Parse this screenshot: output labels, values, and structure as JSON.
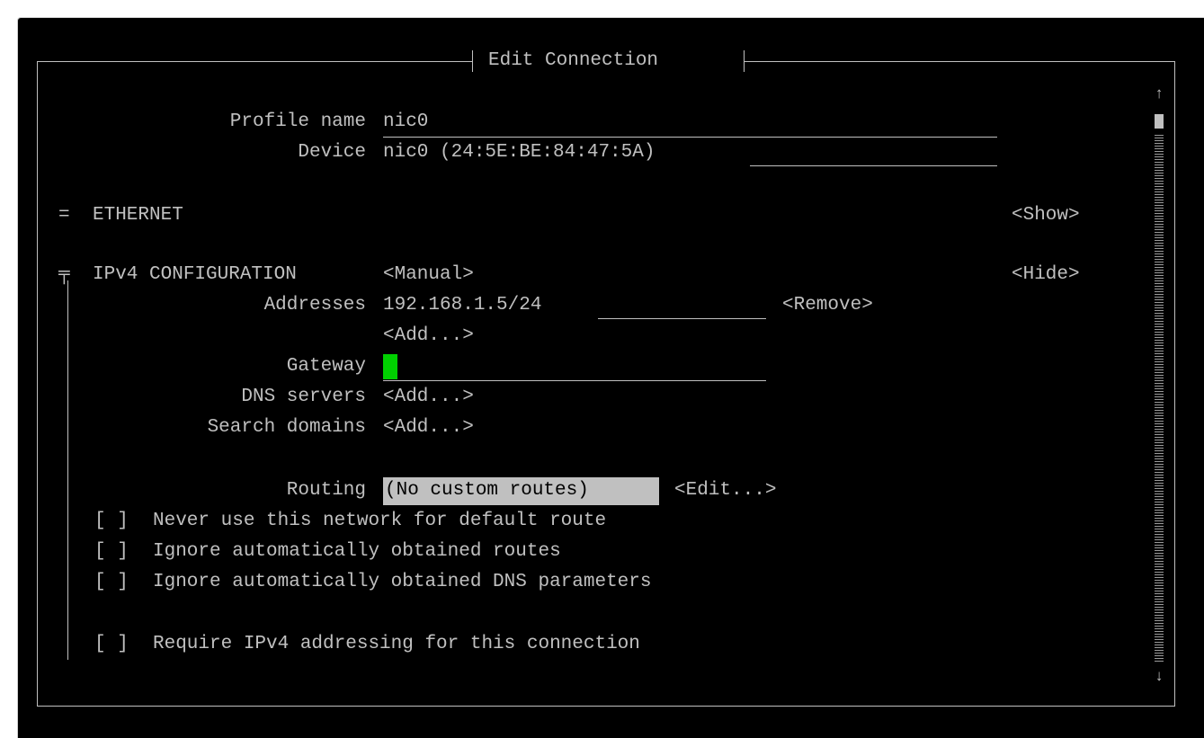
{
  "dialog": {
    "title": "Edit Connection"
  },
  "profile": {
    "label": "Profile name",
    "value": "nic0"
  },
  "device": {
    "label": "Device",
    "value": "nic0 (24:5E:BE:84:47:5A)"
  },
  "ethernet": {
    "marker": "=",
    "label": "ETHERNET",
    "toggle": "<Show>"
  },
  "ipv4": {
    "marker": "╤",
    "label": "IPv4 CONFIGURATION",
    "method": "<Manual>",
    "toggle": "<Hide>",
    "addresses_label": "Addresses",
    "address_value": "192.168.1.5/24",
    "remove_button": "<Remove>",
    "add_address_button": "<Add...>",
    "gateway_label": "Gateway",
    "gateway_value": "",
    "dns_label": "DNS servers",
    "dns_add_button": "<Add...>",
    "search_label": "Search domains",
    "search_add_button": "<Add...>",
    "routing_label": "Routing",
    "routing_value": "(No custom routes)",
    "routing_edit_button": "<Edit...>",
    "checkboxes": [
      {
        "box": "[ ]",
        "label": "Never use this network for default route"
      },
      {
        "box": "[ ]",
        "label": "Ignore automatically obtained routes"
      },
      {
        "box": "[ ]",
        "label": "Ignore automatically obtained DNS parameters"
      }
    ],
    "require_checkbox": {
      "box": "[ ]",
      "label": "Require IPv4 addressing for this connection"
    }
  },
  "scrollbar": {
    "up_arrow": "↑",
    "down_arrow": "↓"
  },
  "colors": {
    "background": "#000000",
    "text": "#c0c0c0",
    "cursor": "#00d000",
    "highlight_bg": "#c0c0c0",
    "highlight_text": "#000000"
  }
}
